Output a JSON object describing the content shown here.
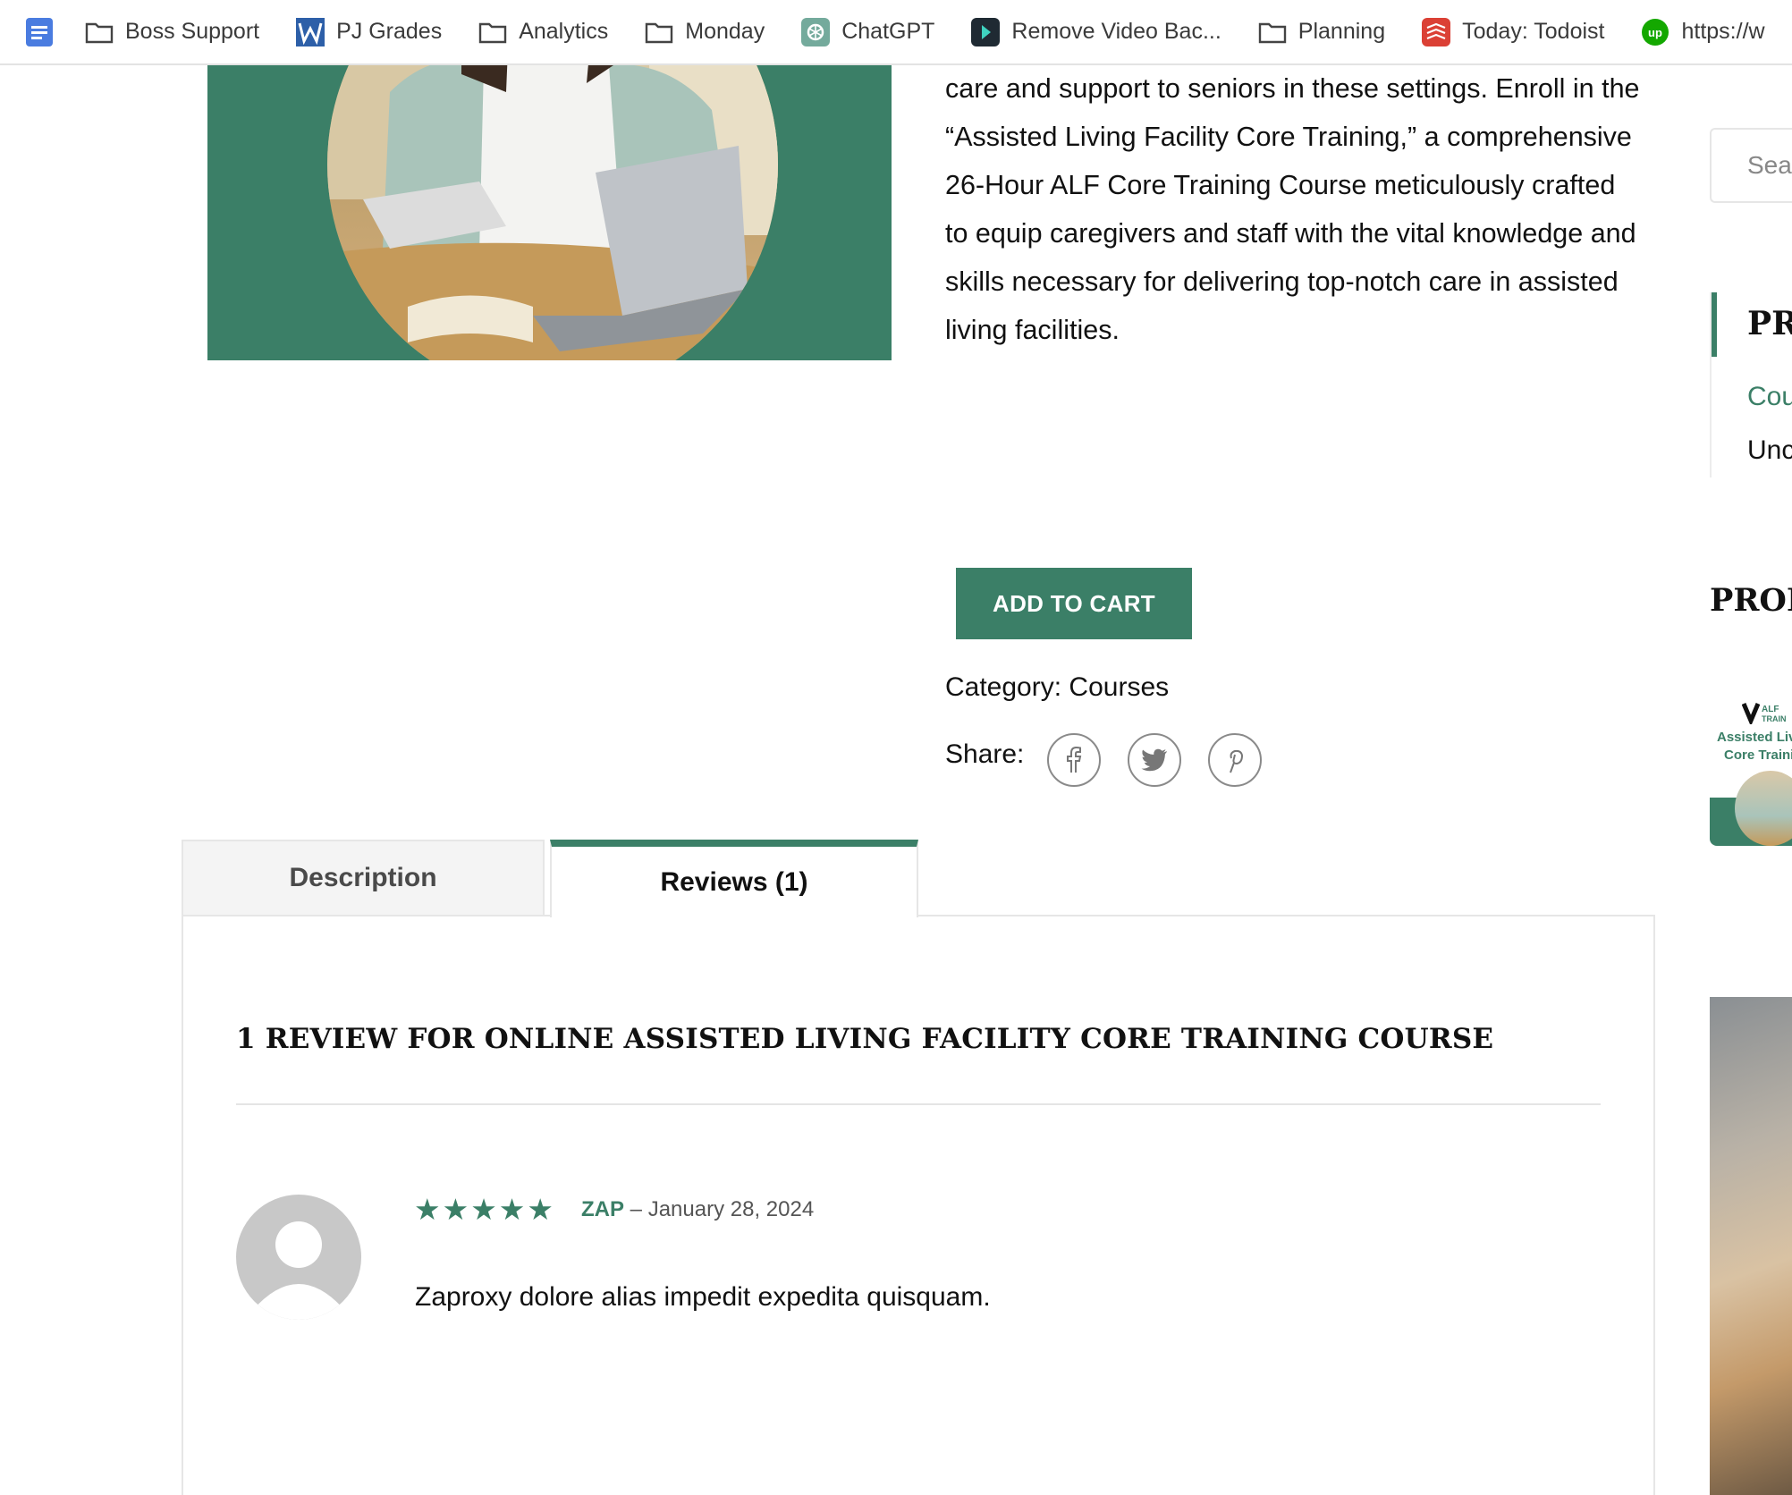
{
  "bookmarks": [
    {
      "label": "Boss Support",
      "icon": "folder-icon"
    },
    {
      "label": "PJ Grades",
      "icon": "w-logo-icon"
    },
    {
      "label": "Analytics",
      "icon": "folder-icon"
    },
    {
      "label": "Monday",
      "icon": "folder-icon"
    },
    {
      "label": "ChatGPT",
      "icon": "chatgpt-icon"
    },
    {
      "label": "Remove Video Bac...",
      "icon": "video-app-icon"
    },
    {
      "label": "Planning",
      "icon": "folder-icon"
    },
    {
      "label": "Today: Todoist",
      "icon": "todoist-icon"
    },
    {
      "label": "https://w",
      "icon": "upwork-icon"
    }
  ],
  "product": {
    "description_lines": [
      "care and support to seniors in these settings. Enroll in the",
      "“Assisted Living Facility Core Training,” a comprehensive",
      "26-Hour ALF Core Training Course meticulously crafted",
      "to equip caregivers and staff with the vital knowledge and",
      "skills necessary for delivering top-notch care in assisted",
      "living facilities."
    ],
    "add_to_cart_label": "ADD TO CART",
    "category_label": "Category:",
    "category_value": "Courses",
    "share_label": "Share:"
  },
  "tabs": {
    "description_label": "Description",
    "reviews_label": "Reviews (1)",
    "active": "reviews"
  },
  "reviews": {
    "title": "1 REVIEW FOR ONLINE ASSISTED LIVING FACILITY CORE TRAINING COURSE",
    "items": [
      {
        "rating": 5,
        "author": "ZAP",
        "separator": "–",
        "date": "January 28, 2024",
        "text": "Zaproxy dolore alias impedit expedita quisquam."
      }
    ]
  },
  "sidebar": {
    "search_placeholder": "Sear",
    "block_heading": "PRO",
    "link_1": "Cou",
    "link_2": "Unc",
    "heading_2": "PROD",
    "thumb_line_1": "Assisted Livi",
    "thumb_line_2": "Core Trainin"
  },
  "colors": {
    "accent": "#3b7f67",
    "border": "#e6e6e6",
    "text": "#111111"
  }
}
